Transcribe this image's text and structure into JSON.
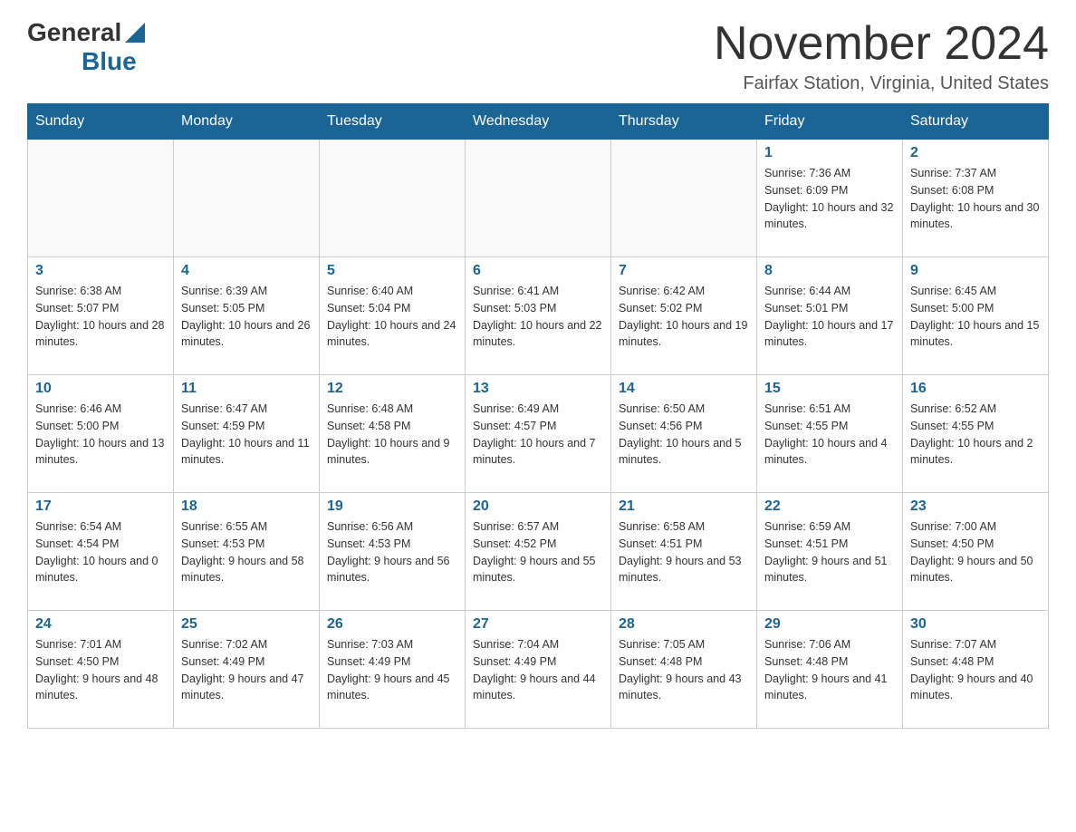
{
  "logo": {
    "general": "General",
    "blue": "Blue"
  },
  "title": "November 2024",
  "subtitle": "Fairfax Station, Virginia, United States",
  "days_of_week": [
    "Sunday",
    "Monday",
    "Tuesday",
    "Wednesday",
    "Thursday",
    "Friday",
    "Saturday"
  ],
  "weeks": [
    [
      {
        "day": "",
        "info": ""
      },
      {
        "day": "",
        "info": ""
      },
      {
        "day": "",
        "info": ""
      },
      {
        "day": "",
        "info": ""
      },
      {
        "day": "",
        "info": ""
      },
      {
        "day": "1",
        "info": "Sunrise: 7:36 AM\nSunset: 6:09 PM\nDaylight: 10 hours and 32 minutes."
      },
      {
        "day": "2",
        "info": "Sunrise: 7:37 AM\nSunset: 6:08 PM\nDaylight: 10 hours and 30 minutes."
      }
    ],
    [
      {
        "day": "3",
        "info": "Sunrise: 6:38 AM\nSunset: 5:07 PM\nDaylight: 10 hours and 28 minutes."
      },
      {
        "day": "4",
        "info": "Sunrise: 6:39 AM\nSunset: 5:05 PM\nDaylight: 10 hours and 26 minutes."
      },
      {
        "day": "5",
        "info": "Sunrise: 6:40 AM\nSunset: 5:04 PM\nDaylight: 10 hours and 24 minutes."
      },
      {
        "day": "6",
        "info": "Sunrise: 6:41 AM\nSunset: 5:03 PM\nDaylight: 10 hours and 22 minutes."
      },
      {
        "day": "7",
        "info": "Sunrise: 6:42 AM\nSunset: 5:02 PM\nDaylight: 10 hours and 19 minutes."
      },
      {
        "day": "8",
        "info": "Sunrise: 6:44 AM\nSunset: 5:01 PM\nDaylight: 10 hours and 17 minutes."
      },
      {
        "day": "9",
        "info": "Sunrise: 6:45 AM\nSunset: 5:00 PM\nDaylight: 10 hours and 15 minutes."
      }
    ],
    [
      {
        "day": "10",
        "info": "Sunrise: 6:46 AM\nSunset: 5:00 PM\nDaylight: 10 hours and 13 minutes."
      },
      {
        "day": "11",
        "info": "Sunrise: 6:47 AM\nSunset: 4:59 PM\nDaylight: 10 hours and 11 minutes."
      },
      {
        "day": "12",
        "info": "Sunrise: 6:48 AM\nSunset: 4:58 PM\nDaylight: 10 hours and 9 minutes."
      },
      {
        "day": "13",
        "info": "Sunrise: 6:49 AM\nSunset: 4:57 PM\nDaylight: 10 hours and 7 minutes."
      },
      {
        "day": "14",
        "info": "Sunrise: 6:50 AM\nSunset: 4:56 PM\nDaylight: 10 hours and 5 minutes."
      },
      {
        "day": "15",
        "info": "Sunrise: 6:51 AM\nSunset: 4:55 PM\nDaylight: 10 hours and 4 minutes."
      },
      {
        "day": "16",
        "info": "Sunrise: 6:52 AM\nSunset: 4:55 PM\nDaylight: 10 hours and 2 minutes."
      }
    ],
    [
      {
        "day": "17",
        "info": "Sunrise: 6:54 AM\nSunset: 4:54 PM\nDaylight: 10 hours and 0 minutes."
      },
      {
        "day": "18",
        "info": "Sunrise: 6:55 AM\nSunset: 4:53 PM\nDaylight: 9 hours and 58 minutes."
      },
      {
        "day": "19",
        "info": "Sunrise: 6:56 AM\nSunset: 4:53 PM\nDaylight: 9 hours and 56 minutes."
      },
      {
        "day": "20",
        "info": "Sunrise: 6:57 AM\nSunset: 4:52 PM\nDaylight: 9 hours and 55 minutes."
      },
      {
        "day": "21",
        "info": "Sunrise: 6:58 AM\nSunset: 4:51 PM\nDaylight: 9 hours and 53 minutes."
      },
      {
        "day": "22",
        "info": "Sunrise: 6:59 AM\nSunset: 4:51 PM\nDaylight: 9 hours and 51 minutes."
      },
      {
        "day": "23",
        "info": "Sunrise: 7:00 AM\nSunset: 4:50 PM\nDaylight: 9 hours and 50 minutes."
      }
    ],
    [
      {
        "day": "24",
        "info": "Sunrise: 7:01 AM\nSunset: 4:50 PM\nDaylight: 9 hours and 48 minutes."
      },
      {
        "day": "25",
        "info": "Sunrise: 7:02 AM\nSunset: 4:49 PM\nDaylight: 9 hours and 47 minutes."
      },
      {
        "day": "26",
        "info": "Sunrise: 7:03 AM\nSunset: 4:49 PM\nDaylight: 9 hours and 45 minutes."
      },
      {
        "day": "27",
        "info": "Sunrise: 7:04 AM\nSunset: 4:49 PM\nDaylight: 9 hours and 44 minutes."
      },
      {
        "day": "28",
        "info": "Sunrise: 7:05 AM\nSunset: 4:48 PM\nDaylight: 9 hours and 43 minutes."
      },
      {
        "day": "29",
        "info": "Sunrise: 7:06 AM\nSunset: 4:48 PM\nDaylight: 9 hours and 41 minutes."
      },
      {
        "day": "30",
        "info": "Sunrise: 7:07 AM\nSunset: 4:48 PM\nDaylight: 9 hours and 40 minutes."
      }
    ]
  ],
  "colors": {
    "header_bg": "#1a6496",
    "header_text": "#ffffff",
    "day_number": "#1a6496",
    "border": "#cccccc"
  }
}
